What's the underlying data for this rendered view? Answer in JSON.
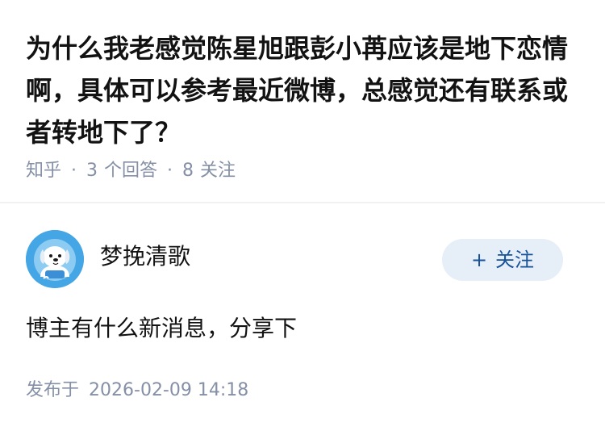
{
  "question": {
    "title": "为什么我老感觉陈星旭跟彭小苒应该是地下恋情啊，具体可以参考最近微博，总感觉还有联系或者转地下了？",
    "source": "知乎",
    "answer_count": "3",
    "answer_label": "个回答",
    "follower_count": "8",
    "follower_label": "关注",
    "separator": "·"
  },
  "answer": {
    "author_name": "梦挽清歌",
    "avatar_icon": "cartoon-dog-avatar-icon",
    "follow_plus": "+",
    "follow_label": "关注",
    "content": "博主有什么新消息，分享下",
    "publish_label": "发布于",
    "publish_time": "2026-02-09 14:18"
  },
  "colors": {
    "title": "#121212",
    "meta": "#8590a6",
    "follow_bg": "#e6eef8",
    "follow_text": "#175199",
    "avatar_bg": "#45a6e6"
  }
}
